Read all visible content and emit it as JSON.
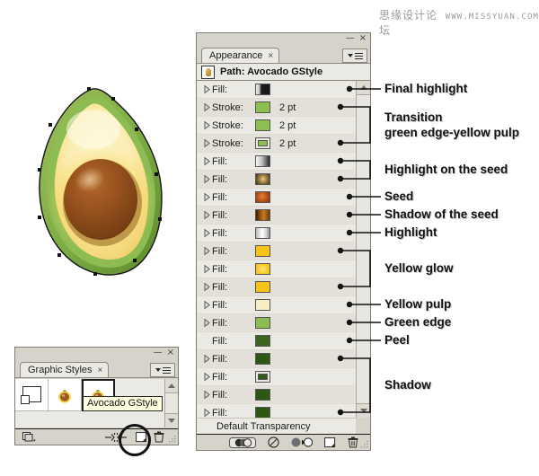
{
  "watermark": {
    "cn": "思缘设计论坛",
    "en": "WWW.MISSYUAN.COM"
  },
  "artwork": {
    "name": "avocado-half-illustration",
    "alt": "Half avocado with green peel, yellow pulp and brown seed, shown with vector anchor points"
  },
  "appearance_panel": {
    "tab_label": "Appearance",
    "tab_close": "×",
    "minimize": "—",
    "close": "×",
    "path_title": "Path: Avocado GStyle",
    "default_transparency": "Default Transparency",
    "rows": [
      {
        "type": "Fill:",
        "value": "",
        "swatch": "dark-gradient",
        "color": "#2b2b2b",
        "expandable": true,
        "double_border": false
      },
      {
        "type": "Stroke:",
        "value": "2 pt",
        "swatch": "green-flat",
        "color": "#8dbf4e",
        "expandable": true,
        "double_border": false
      },
      {
        "type": "Stroke:",
        "value": "2 pt",
        "swatch": "green-flat",
        "color": "#8dbf4e",
        "expandable": true,
        "double_border": false
      },
      {
        "type": "Stroke:",
        "value": "2 pt",
        "swatch": "green-flat",
        "color": "#8dbf4e",
        "expandable": true,
        "double_border": true
      },
      {
        "type": "Fill:",
        "value": "",
        "swatch": "white-black-gradient",
        "color": "#bdbdbd",
        "expandable": true,
        "double_border": false
      },
      {
        "type": "Fill:",
        "value": "",
        "swatch": "tan-radial-dark",
        "color": "#c9a96a",
        "expandable": true,
        "double_border": false
      },
      {
        "type": "Fill:",
        "value": "",
        "swatch": "orange-radial",
        "color": "#c4551a",
        "expandable": true,
        "double_border": false
      },
      {
        "type": "Fill:",
        "value": "",
        "swatch": "brown-gradient",
        "color": "#8a4a08",
        "expandable": true,
        "double_border": false
      },
      {
        "type": "Fill:",
        "value": "",
        "swatch": "white-gray-gradient",
        "color": "#e8e8e8",
        "expandable": true,
        "double_border": false
      },
      {
        "type": "Fill:",
        "value": "",
        "swatch": "yellow-flat",
        "color": "#f8c212",
        "expandable": true,
        "double_border": false
      },
      {
        "type": "Fill:",
        "value": "",
        "swatch": "yellow-radial",
        "color": "#f7c82a",
        "expandable": true,
        "double_border": false
      },
      {
        "type": "Fill:",
        "value": "",
        "swatch": "yellow-flat",
        "color": "#f8c212",
        "expandable": true,
        "double_border": false
      },
      {
        "type": "Fill:",
        "value": "",
        "swatch": "pale-cream",
        "color": "#f7eec4",
        "expandable": true,
        "double_border": false
      },
      {
        "type": "Fill:",
        "value": "",
        "swatch": "light-green",
        "color": "#8cbc52",
        "expandable": true,
        "double_border": false
      },
      {
        "type": "Fill:",
        "value": "",
        "swatch": "dark-green",
        "color": "#3d6320",
        "expandable": false,
        "double_border": false
      },
      {
        "type": "Fill:",
        "value": "",
        "swatch": "dark-green",
        "color": "#2f5714",
        "expandable": true,
        "double_border": false
      },
      {
        "type": "Fill:",
        "value": "",
        "swatch": "dark-green",
        "color": "#34591a",
        "expandable": true,
        "double_border": true
      },
      {
        "type": "Fill:",
        "value": "",
        "swatch": "dark-green",
        "color": "#2f5714",
        "expandable": true,
        "double_border": false
      },
      {
        "type": "Fill:",
        "value": "",
        "swatch": "dark-green",
        "color": "#2f5714",
        "expandable": true,
        "double_border": false
      }
    ],
    "footer_icons": [
      {
        "name": "new-art-has-basic-appearance-icon"
      },
      {
        "name": "clear-appearance-icon"
      },
      {
        "name": "reduce-to-basic-appearance-icon"
      },
      {
        "name": "duplicate-selected-item-icon"
      },
      {
        "name": "delete-selected-item-icon"
      }
    ]
  },
  "graphic_styles_panel": {
    "tab_label": "Graphic Styles",
    "tab_close": "×",
    "minimize": "—",
    "close": "×",
    "tooltip": "Avocado GStyle",
    "swatches": [
      {
        "name": "none-style",
        "selected": false
      },
      {
        "name": "avocado-style-preview",
        "selected": false
      },
      {
        "name": "avocado-gstyle",
        "selected": true
      }
    ],
    "footer_icons": [
      {
        "name": "graphic-styles-libraries-menu-icon"
      },
      {
        "name": "break-link-to-graphic-style-icon"
      },
      {
        "name": "new-graphic-style-icon"
      },
      {
        "name": "delete-graphic-style-icon"
      }
    ]
  },
  "callouts": [
    {
      "id": "final-highlight",
      "text": "Final highlight",
      "text2": "",
      "kind": "single",
      "rows": [
        0
      ]
    },
    {
      "id": "transition",
      "text": "Transition",
      "text2": "green edge-yellow pulp",
      "kind": "bracket",
      "rows": [
        1,
        3
      ]
    },
    {
      "id": "highlight-on-seed",
      "text": "Highlight on the seed",
      "text2": "",
      "kind": "bracket",
      "rows": [
        4,
        5
      ]
    },
    {
      "id": "seed",
      "text": "Seed",
      "text2": "",
      "kind": "single",
      "rows": [
        6
      ]
    },
    {
      "id": "shadow-of-seed",
      "text": "Shadow of the seed",
      "text2": "",
      "kind": "single",
      "rows": [
        7
      ]
    },
    {
      "id": "highlight",
      "text": "Highlight",
      "text2": "",
      "kind": "single",
      "rows": [
        8
      ]
    },
    {
      "id": "yellow-glow",
      "text": "Yellow glow",
      "text2": "",
      "kind": "bracket",
      "rows": [
        9,
        11
      ]
    },
    {
      "id": "yellow-pulp",
      "text": "Yellow pulp",
      "text2": "",
      "kind": "single",
      "rows": [
        12
      ]
    },
    {
      "id": "green-edge",
      "text": "Green edge",
      "text2": "",
      "kind": "single",
      "rows": [
        13
      ]
    },
    {
      "id": "peel",
      "text": "Peel",
      "text2": "",
      "kind": "single",
      "rows": [
        14
      ]
    },
    {
      "id": "shadow",
      "text": "Shadow",
      "text2": "",
      "kind": "bracket",
      "rows": [
        15,
        18
      ]
    }
  ],
  "colors": {
    "panel_face": "#d6d3ca",
    "panel_body": "#ebe9e3",
    "row_alt": "#e2e0d9",
    "border": "#7e7c75",
    "text": "#1a1a1a",
    "tooltip_bg": "#ffffe1"
  }
}
